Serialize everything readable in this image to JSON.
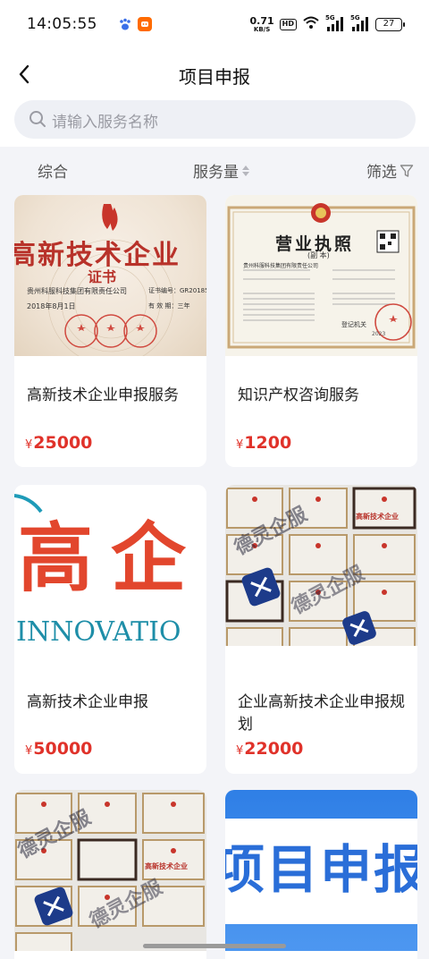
{
  "status_bar": {
    "time": "14:05:55",
    "net_speed_value": "0.71",
    "net_speed_unit": "KB/S",
    "hd_label": "HD",
    "signal_1_label": "5G",
    "signal_2_label": "5G",
    "battery": "27"
  },
  "nav": {
    "title": "项目申报"
  },
  "search": {
    "placeholder": "请输入服务名称"
  },
  "filters": {
    "comprehensive": "综合",
    "sales": "服务量",
    "screen": "筛选"
  },
  "cards": [
    {
      "title": "高新技术企业申报服务",
      "currency": "¥",
      "price": "25000",
      "image_texts": {
        "heading": "高新技术企业",
        "sub": "证书",
        "company": "贵州科服科技集团有限责任公司",
        "cert_no_label": "证书编号：",
        "cert_no": "GR2018520",
        "date": "2018年8月1日",
        "validity": "有 效 期：三年"
      }
    },
    {
      "title": "知识产权咨询服务",
      "currency": "¥",
      "price": "1200",
      "image_texts": {
        "heading": "营业执照",
        "sub": "(副 本)",
        "company": "贵州科服科技集团有限责任公司",
        "office": "登记机关",
        "year": "2023"
      }
    },
    {
      "title": "高新技术企业申报",
      "currency": "¥",
      "price": "50000",
      "image_texts": {
        "big": "高企",
        "word": "INNOVATIO"
      }
    },
    {
      "title": "企业高新技术企业申报规划",
      "currency": "¥",
      "price": "22000",
      "image_texts": {
        "watermark": "德灵企服",
        "mini_cert": "高新技术企业"
      }
    },
    {
      "title": "",
      "price": "",
      "image_texts": {
        "watermark": "德灵企服",
        "mini_cert": "高新技术企业"
      }
    },
    {
      "title": "",
      "price": "",
      "image_texts": {
        "banner": "项目申报"
      }
    }
  ],
  "colors": {
    "price": "#e0322a",
    "page_bg": "#f3f4f8",
    "card_bg": "#ffffff",
    "search_bg": "#eef0f5",
    "banner_blue": "#2f7fe6"
  },
  "icons": {
    "back": "chevron-left-icon",
    "search": "search-icon",
    "sort": "sort-icon",
    "filter": "filter-funnel-icon"
  }
}
